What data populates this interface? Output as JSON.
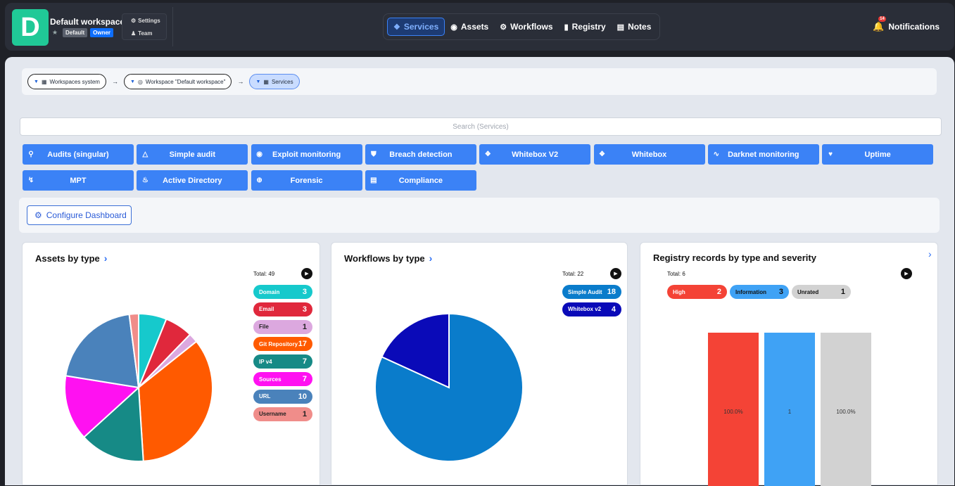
{
  "workspace": {
    "logo_letter": "D",
    "title": "Default workspace",
    "tag_default": "Default",
    "tag_owner": "Owner",
    "menu": [
      "Settings",
      "Team"
    ]
  },
  "nav": [
    {
      "label": "Services",
      "icon": "tag-icon",
      "active": true
    },
    {
      "label": "Assets",
      "icon": "target-icon"
    },
    {
      "label": "Workflows",
      "icon": "gears-icon"
    },
    {
      "label": "Registry",
      "icon": "book-icon"
    },
    {
      "label": "Notes",
      "icon": "note-icon"
    }
  ],
  "notifications": {
    "label": "Notifications",
    "count": "14"
  },
  "breadcrumb": [
    "Workspaces system",
    "Workspace \"Default workspace\"",
    "Services"
  ],
  "search": {
    "placeholder": "Search (Services)"
  },
  "services": [
    {
      "label": "Audits (singular)",
      "icon": "search-icon"
    },
    {
      "label": "Simple audit",
      "icon": "radar-icon"
    },
    {
      "label": "Exploit monitoring",
      "icon": "eye-icon"
    },
    {
      "label": "Breach detection",
      "icon": "shield-icon"
    },
    {
      "label": "Whitebox V2",
      "icon": "dropbox-icon"
    },
    {
      "label": "Whitebox",
      "icon": "dropbox-icon"
    },
    {
      "label": "Darknet monitoring",
      "icon": "rss-icon"
    },
    {
      "label": "Uptime",
      "icon": "heartbeat-icon"
    },
    {
      "label": "MPT",
      "icon": "bolt-icon"
    },
    {
      "label": "Active Directory",
      "icon": "fire-icon"
    },
    {
      "label": "Forensic",
      "icon": "crosshair-icon"
    },
    {
      "label": "Compliance",
      "icon": "clipboard-icon"
    }
  ],
  "configure": {
    "label": "Configure Dashboard"
  },
  "colors": {
    "accent": "#3b82f6"
  },
  "cards": {
    "assets": {
      "title": "Assets by type",
      "total": "Total: 49"
    },
    "workflows": {
      "title": "Workflows by type",
      "total": "Total: 22"
    },
    "registry": {
      "title": "Registry records by type and severity",
      "total": "Total: 6"
    }
  },
  "chart_data": [
    {
      "type": "pie",
      "series": [
        {
          "values": [
            3,
            3,
            1,
            17,
            7,
            7,
            10,
            1
          ]
        }
      ],
      "categories": [
        "Domain",
        "Email",
        "File",
        "Git Repository",
        "IP v4",
        "Sources",
        "URL",
        "Username"
      ],
      "colors": [
        "#16c9cc",
        "#e0283c",
        "#dca8df",
        "#ff5a00",
        "#168a86",
        "#ff11f1",
        "#4a82bb",
        "#f08d8a"
      ]
    },
    {
      "type": "pie",
      "series": [
        {
          "values": [
            18,
            4
          ]
        }
      ],
      "categories": [
        "Simple Audit",
        "Whitebox v2"
      ],
      "colors": [
        "#0a7ccb",
        "#0a0ab8"
      ]
    },
    {
      "type": "bar",
      "categories": [
        "High",
        "Information",
        "Unrated"
      ],
      "series": [
        {
          "values": [
            2,
            3,
            1
          ]
        }
      ],
      "bar_labels": [
        "100.0%",
        "1",
        "100.0%"
      ],
      "colors": [
        "#f44336",
        "#3fa2f5",
        "#d2d2d2"
      ],
      "stacked": true
    }
  ]
}
